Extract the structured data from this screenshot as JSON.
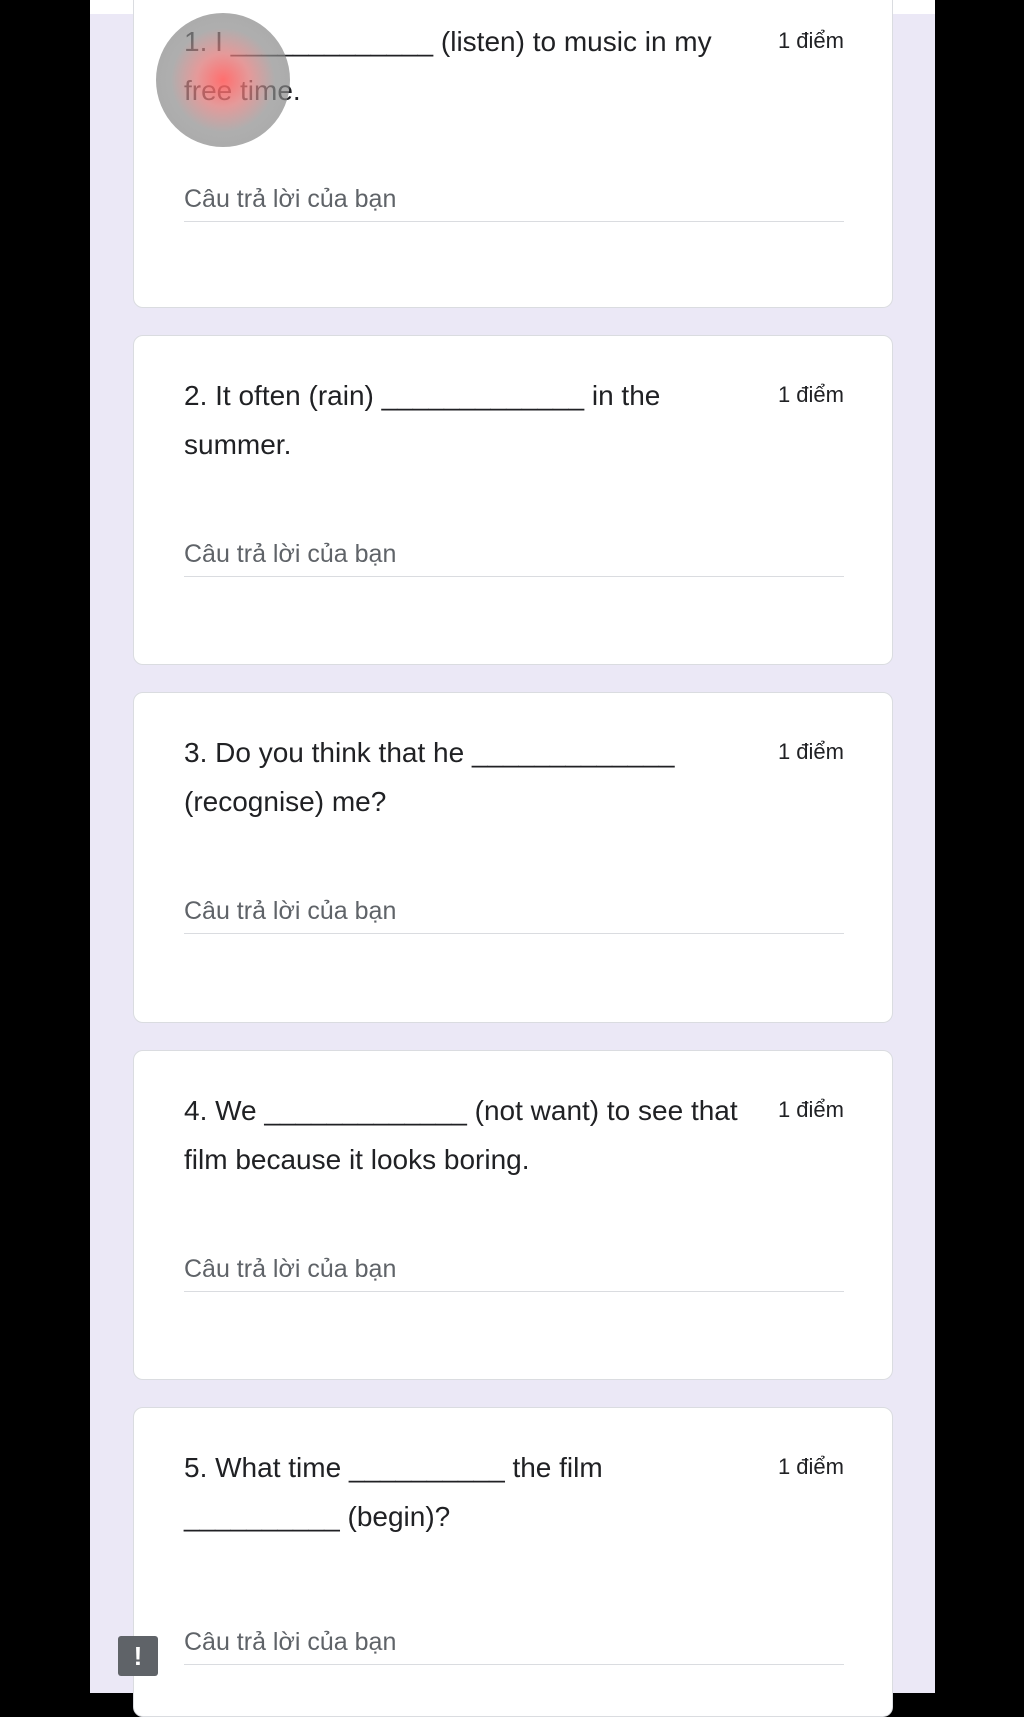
{
  "form": {
    "questions": [
      {
        "text": "1. I _____________ (listen) to music in my free time.",
        "points": "1 điểm",
        "answer_placeholder": "Câu trả lời của bạn",
        "answer_value": ""
      },
      {
        "text": "2. It often (rain) _____________ in the summer.",
        "points": "1 điểm",
        "answer_placeholder": "Câu trả lời của bạn",
        "answer_value": ""
      },
      {
        "text": "3. Do you think that he _____________ (recognise) me?",
        "points": "1 điểm",
        "answer_placeholder": "Câu trả lời của bạn",
        "answer_value": ""
      },
      {
        "text": "4. We _____________ (not want) to see that film because it looks boring.",
        "points": "1 điểm",
        "answer_placeholder": "Câu trả lời của bạn",
        "answer_value": ""
      },
      {
        "text": "5. What time __________ the film __________ (begin)?",
        "points": "1 điểm",
        "answer_placeholder": "Câu trả lời của bạn",
        "answer_value": ""
      }
    ]
  },
  "warning_badge": {
    "icon": "exclamation-icon",
    "glyph": "!"
  },
  "colors": {
    "page_background": "#ebe8f6",
    "card_background": "#ffffff",
    "accent": "#3f84f4",
    "text": "#202124",
    "placeholder": "#5f6368"
  }
}
